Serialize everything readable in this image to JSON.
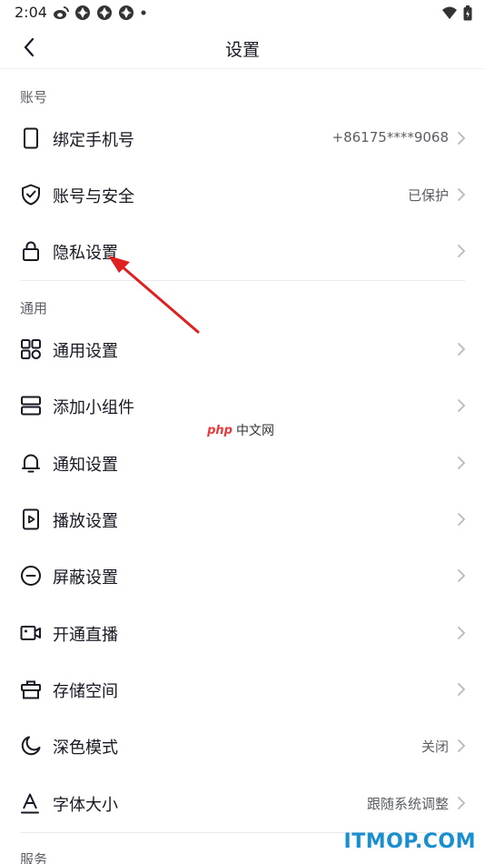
{
  "status_bar": {
    "time": "2:04",
    "left_icons": [
      "weibo-icon",
      "app-icon",
      "app-icon",
      "app-icon",
      "dot-icon"
    ],
    "right_icons": [
      "wifi-icon",
      "battery-icon"
    ]
  },
  "nav": {
    "title": "设置",
    "back_icon": "chevron-left-icon"
  },
  "sections": [
    {
      "header": "账号",
      "items": [
        {
          "label": "绑定手机号",
          "value": "+86175****9068",
          "icon": "phone-icon"
        },
        {
          "label": "账号与安全",
          "value": "已保护",
          "icon": "shield-icon"
        },
        {
          "label": "隐私设置",
          "value": "",
          "icon": "lock-icon"
        }
      ]
    },
    {
      "header": "通用",
      "items": [
        {
          "label": "通用设置",
          "value": "",
          "icon": "grid-icon"
        },
        {
          "label": "添加小组件",
          "value": "",
          "icon": "widget-icon"
        },
        {
          "label": "通知设置",
          "value": "",
          "icon": "bell-icon"
        },
        {
          "label": "播放设置",
          "value": "",
          "icon": "play-icon"
        },
        {
          "label": "屏蔽设置",
          "value": "",
          "icon": "block-icon"
        },
        {
          "label": "开通直播",
          "value": "",
          "icon": "live-camera-icon"
        },
        {
          "label": "存储空间",
          "value": "",
          "icon": "storage-icon"
        },
        {
          "label": "深色模式",
          "value": "关闭",
          "icon": "moon-icon"
        },
        {
          "label": "字体大小",
          "value": "跟随系统调整",
          "icon": "font-size-icon"
        }
      ]
    },
    {
      "header": "服务",
      "items": []
    }
  ],
  "watermarks": {
    "php_logo": "php",
    "php_site": "中文网",
    "itmop": "ITMOP.COM"
  },
  "colors": {
    "text_primary": "#161823",
    "text_secondary": "#5c5e66",
    "chevron": "#b8b9bd",
    "annotation_arrow": "#e02020",
    "itmop_blue": "#1a8fd0"
  }
}
